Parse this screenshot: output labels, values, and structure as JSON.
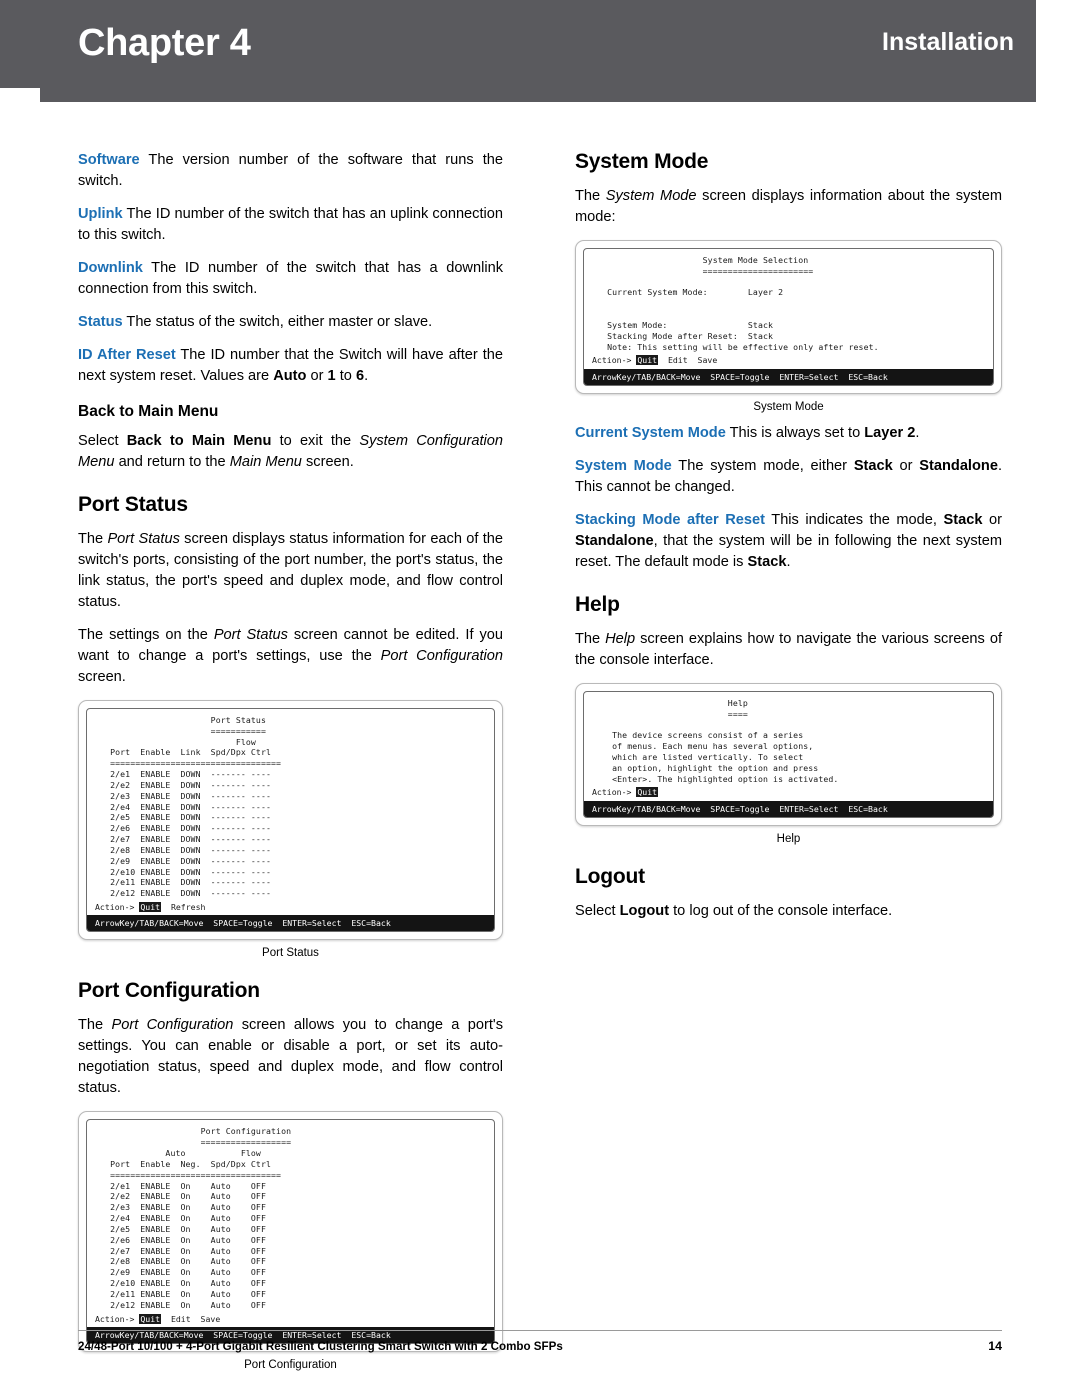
{
  "header": {
    "chapter_label": "Chapter",
    "chapter_number": "4",
    "section_title": "Installation"
  },
  "left": {
    "p_software_lead": "Software",
    "p_software_text": "  The version number of the software that runs the switch.",
    "p_uplink_lead": "Uplink",
    "p_uplink_text": "  The ID number of the switch that has an uplink connection to this switch.",
    "p_downlink_lead": "Downlink",
    "p_downlink_text": "  The ID number of the switch that has a downlink connection from this switch.",
    "p_status_lead": "Status",
    "p_status_text": "  The status of the switch, either master or slave.",
    "p_idafter_lead": "ID After Reset",
    "p_idafter_text_1": "  The ID number that the Switch will have after the next system reset. Values are ",
    "p_idafter_b1": "Auto",
    "p_idafter_text_2": " or ",
    "p_idafter_b2": "1",
    "p_idafter_text_3": " to ",
    "p_idafter_b3": "6",
    "p_idafter_text_4": ".",
    "h_back_to_main": "Back to Main Menu",
    "p_back_1": "Select ",
    "p_back_b1": "Back to Main Menu",
    "p_back_2": " to exit the ",
    "p_back_i1": "System Configuration Menu",
    "p_back_3": " and return to the ",
    "p_back_i2": "Main Menu",
    "p_back_4": " screen.",
    "h_port_status": "Port Status",
    "p_ps_1": "The ",
    "p_ps_i1": "Port Status",
    "p_ps_2": " screen displays status information for each of the switch's ports, consisting of the port number, the port's status, the link status, the port's speed and duplex mode, and flow control status.",
    "p_ps2_1": "The settings on the ",
    "p_ps2_i1": "Port Status",
    "p_ps2_2": " screen cannot be edited. If you want to change a port's settings, use the ",
    "p_ps2_i2": "Port Configuration",
    "p_ps2_3": " screen.",
    "h_port_config": "Port Configuration",
    "p_pc_1": "The ",
    "p_pc_i1": "Port Configuration",
    "p_pc_2": " screen allows you to change a port's settings. You can enable or disable a port, or set its auto-negotiation status, speed and duplex mode, and flow control status."
  },
  "right": {
    "h_system_mode": "System Mode",
    "p_sm_1": "The ",
    "p_sm_i1": "System Mode",
    "p_sm_2": " screen displays information about the system mode:",
    "p_csm_lead": "Current System Mode",
    "p_csm_1": "  This is always set to ",
    "p_csm_b1": "Layer 2",
    "p_csm_2": ".",
    "p_smm_lead": "System Mode",
    "p_smm_1": " The system mode, either ",
    "p_smm_b1": "Stack",
    "p_smm_2": " or ",
    "p_smm_b2": "Standalone",
    "p_smm_3": ". This cannot be changed.",
    "p_smr_lead": "Stacking Mode after Reset",
    "p_smr_1": " This indicates the mode, ",
    "p_smr_b1": "Stack",
    "p_smr_2": " or ",
    "p_smr_b2": "Standalone",
    "p_smr_3": ", that the system will be in following the next system reset. The default mode is ",
    "p_smr_b3": "Stack",
    "p_smr_4": ".",
    "h_help": "Help",
    "p_help_1": "The ",
    "p_help_i1": "Help",
    "p_help_2": " screen explains how to navigate the various screens of the console interface.",
    "h_logout": "Logout",
    "p_logout_1": "Select ",
    "p_logout_b1": "Logout",
    "p_logout_2": " to log out of the console interface."
  },
  "figures": {
    "system_mode": {
      "caption": "System Mode",
      "screen_text": "                      System Mode Selection\n                      ======================\n\n   Current System Mode:        Layer 2\n\n\n   System Mode:                Stack\n   Stacking Mode after Reset:  Stack\n   Note: This setting will be effective only after reset.\n",
      "action_prefix": "Action-> ",
      "action_selected": "Quit",
      "action_rest": "  Edit  Save",
      "status_line": "ArrowKey/TAB/BACK=Move  SPACE=Toggle  ENTER=Select  ESC=Back"
    },
    "port_status": {
      "caption": "Port Status",
      "screen_text": "                       Port Status\n                       ===========\n                            Flow\n   Port  Enable  Link  Spd/Dpx Ctrl\n   ==================================\n   2/e1  ENABLE  DOWN  ------- ----\n   2/e2  ENABLE  DOWN  ------- ----\n   2/e3  ENABLE  DOWN  ------- ----\n   2/e4  ENABLE  DOWN  ------- ----\n   2/e5  ENABLE  DOWN  ------- ----\n   2/e6  ENABLE  DOWN  ------- ----\n   2/e7  ENABLE  DOWN  ------- ----\n   2/e8  ENABLE  DOWN  ------- ----\n   2/e9  ENABLE  DOWN  ------- ----\n   2/e10 ENABLE  DOWN  ------- ----\n   2/e11 ENABLE  DOWN  ------- ----\n   2/e12 ENABLE  DOWN  ------- ----\n",
      "action_prefix": "Action-> ",
      "action_selected": "Quit",
      "action_rest": "  Refresh",
      "status_line": "ArrowKey/TAB/BACK=Move  SPACE=Toggle  ENTER=Select  ESC=Back"
    },
    "port_config": {
      "caption": "Port Configuration",
      "screen_text": "                     Port Configuration\n                     ==================\n              Auto           Flow\n   Port  Enable  Neg.  Spd/Dpx Ctrl\n   ==================================\n   2/e1  ENABLE  On    Auto    OFF\n   2/e2  ENABLE  On    Auto    OFF\n   2/e3  ENABLE  On    Auto    OFF\n   2/e4  ENABLE  On    Auto    OFF\n   2/e5  ENABLE  On    Auto    OFF\n   2/e6  ENABLE  On    Auto    OFF\n   2/e7  ENABLE  On    Auto    OFF\n   2/e8  ENABLE  On    Auto    OFF\n   2/e9  ENABLE  On    Auto    OFF\n   2/e10 ENABLE  On    Auto    OFF\n   2/e11 ENABLE  On    Auto    OFF\n   2/e12 ENABLE  On    Auto    OFF\n",
      "action_prefix": "Action-> ",
      "action_selected": "Quit",
      "action_rest": "  Edit  Save",
      "status_line": "ArrowKey/TAB/BACK=Move  SPACE=Toggle  ENTER=Select  ESC=Back"
    },
    "help": {
      "caption": "Help",
      "screen_text": "                           Help\n                           ====\n\n    The device screens consist of a series\n    of menus. Each menu has several options,\n    which are listed vertically. To select\n    an option, highlight the option and press\n    <Enter>. The highlighted option is activated.\n",
      "action_prefix": "Action-> ",
      "action_selected": "Quit",
      "action_rest": "",
      "status_line": "ArrowKey/TAB/BACK=Move  SPACE=Toggle  ENTER=Select  ESC=Back"
    }
  },
  "footer": {
    "text": "24/48-Port 10/100 + 4-Port Gigabit Resilient Clustering Smart Switch with 2 Combo SFPs",
    "page": "14"
  }
}
